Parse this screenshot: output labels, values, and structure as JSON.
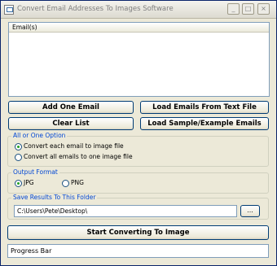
{
  "window": {
    "title": "Convert Email Addresses To Images Software"
  },
  "titlebar": {
    "minimize": "_",
    "maximize": "□",
    "close": "×"
  },
  "email_list": {
    "header": "Email(s)"
  },
  "buttons": {
    "add_one": "Add One Email",
    "load_text": "Load Emails From Text File",
    "clear": "Clear List",
    "load_sample": "Load Sample/Example Emails",
    "start": "Start Converting To Image"
  },
  "option_group": {
    "legend": "All or One Option",
    "each": "Convert each email to image file",
    "all": "Convert all emails to one image file",
    "selected": "each"
  },
  "format_group": {
    "legend": "Output Format",
    "jpg": "JPG",
    "png": "PNG",
    "selected": "jpg"
  },
  "save_group": {
    "legend": "Save Results To This Folder",
    "path": "C:\\Users\\Pete\\Desktop\\",
    "browse": "..."
  },
  "progress": {
    "label": "Progress Bar"
  }
}
